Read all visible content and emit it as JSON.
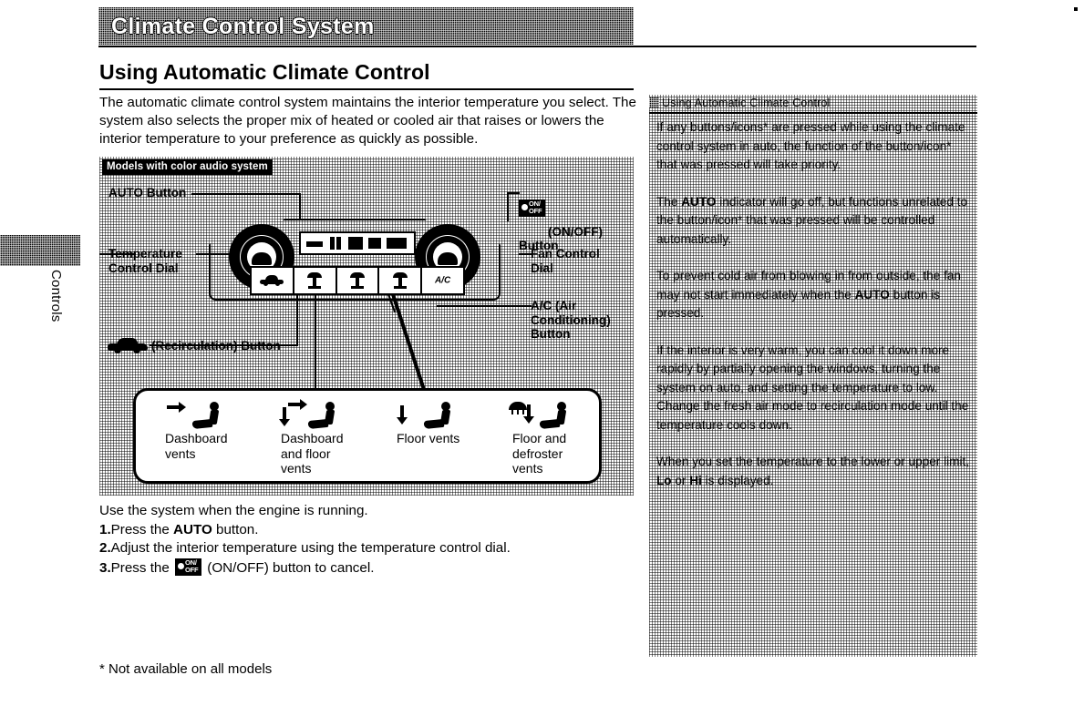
{
  "side_tab": {
    "label": "Controls"
  },
  "banner": {
    "title": "Climate Control System"
  },
  "page_title": "Using Automatic Climate Control",
  "intro": "The automatic climate control system maintains the interior temperature you select. The system also selects the proper mix of heated or cooled air that raises or lowers the interior temperature to your preference as quickly as possible.",
  "illustration": {
    "caption": "Models with color audio system",
    "callouts": {
      "auto_button": "AUTO Button",
      "onoff_button": "(ON/OFF) Button",
      "temperature_dial": "Temperature\nControl Dial",
      "fan_dial": "Fan Control\nDial",
      "ac_button": "A/C (Air\nConditioning)\nButton",
      "recirculation_button": "(Recirculation) Button"
    },
    "onoff_glyph": {
      "top": "ON/",
      "bottom": "OFF"
    },
    "panel_buttons": [
      {
        "name": "recirculation",
        "icon": "car-icon"
      },
      {
        "name": "dashboard-vent",
        "icon": "vent-icon"
      },
      {
        "name": "floor-vent",
        "icon": "vent-icon"
      },
      {
        "name": "defroster",
        "icon": "defroster-icon"
      },
      {
        "name": "air-conditioning",
        "icon": "ac-text-icon",
        "label": "A/C"
      }
    ],
    "vent_modes": [
      {
        "label": "Dashboard\nvents",
        "icon": "seat-dashboard-icon"
      },
      {
        "label": "Dashboard\nand floor\nvents",
        "icon": "seat-dashboard-floor-icon"
      },
      {
        "label": "Floor vents",
        "icon": "seat-floor-icon"
      },
      {
        "label": "Floor and\ndefroster\nvents",
        "icon": "seat-floor-defroster-icon"
      }
    ]
  },
  "procedure": {
    "lead": "Use the system when the engine is running.",
    "step1_num": "1.",
    "step1_a": "Press the ",
    "step1_b": "AUTO",
    "step1_c": " button.",
    "step2_num": "2.",
    "step2_text": "Adjust the interior temperature using the temperature control dial.",
    "step3_num": "3.",
    "step3_a": "Press the ",
    "step3_c": " (ON/OFF) button to cancel."
  },
  "footnote": "* Not available on all models",
  "sidebar": {
    "title": "Using Automatic Climate Control",
    "paragraphs": [
      "If any buttons/icons* are pressed while using the climate control system in auto, the function of the button/icon* that was pressed will take priority.",
      "The AUTO indicator will go off, but functions unrelated to the button/icon* that was pressed will be controlled automatically.",
      "To prevent cold air from blowing in from outside, the fan may not start immediately when the AUTO button is pressed.",
      "If the interior is very warm, you can cool it down more rapidly by partially opening the windows, turning the system on auto, and setting the temperature to low. Change the fresh air mode to recirculation mode until the temperature cools down.",
      "When you set the temperature to the lower or upper limit, Lo or Hi is displayed."
    ],
    "emphasis_terms": [
      "AUTO",
      "Lo",
      "Hi"
    ]
  },
  "colors": {
    "ink": "#000000",
    "paper": "#ffffff"
  }
}
